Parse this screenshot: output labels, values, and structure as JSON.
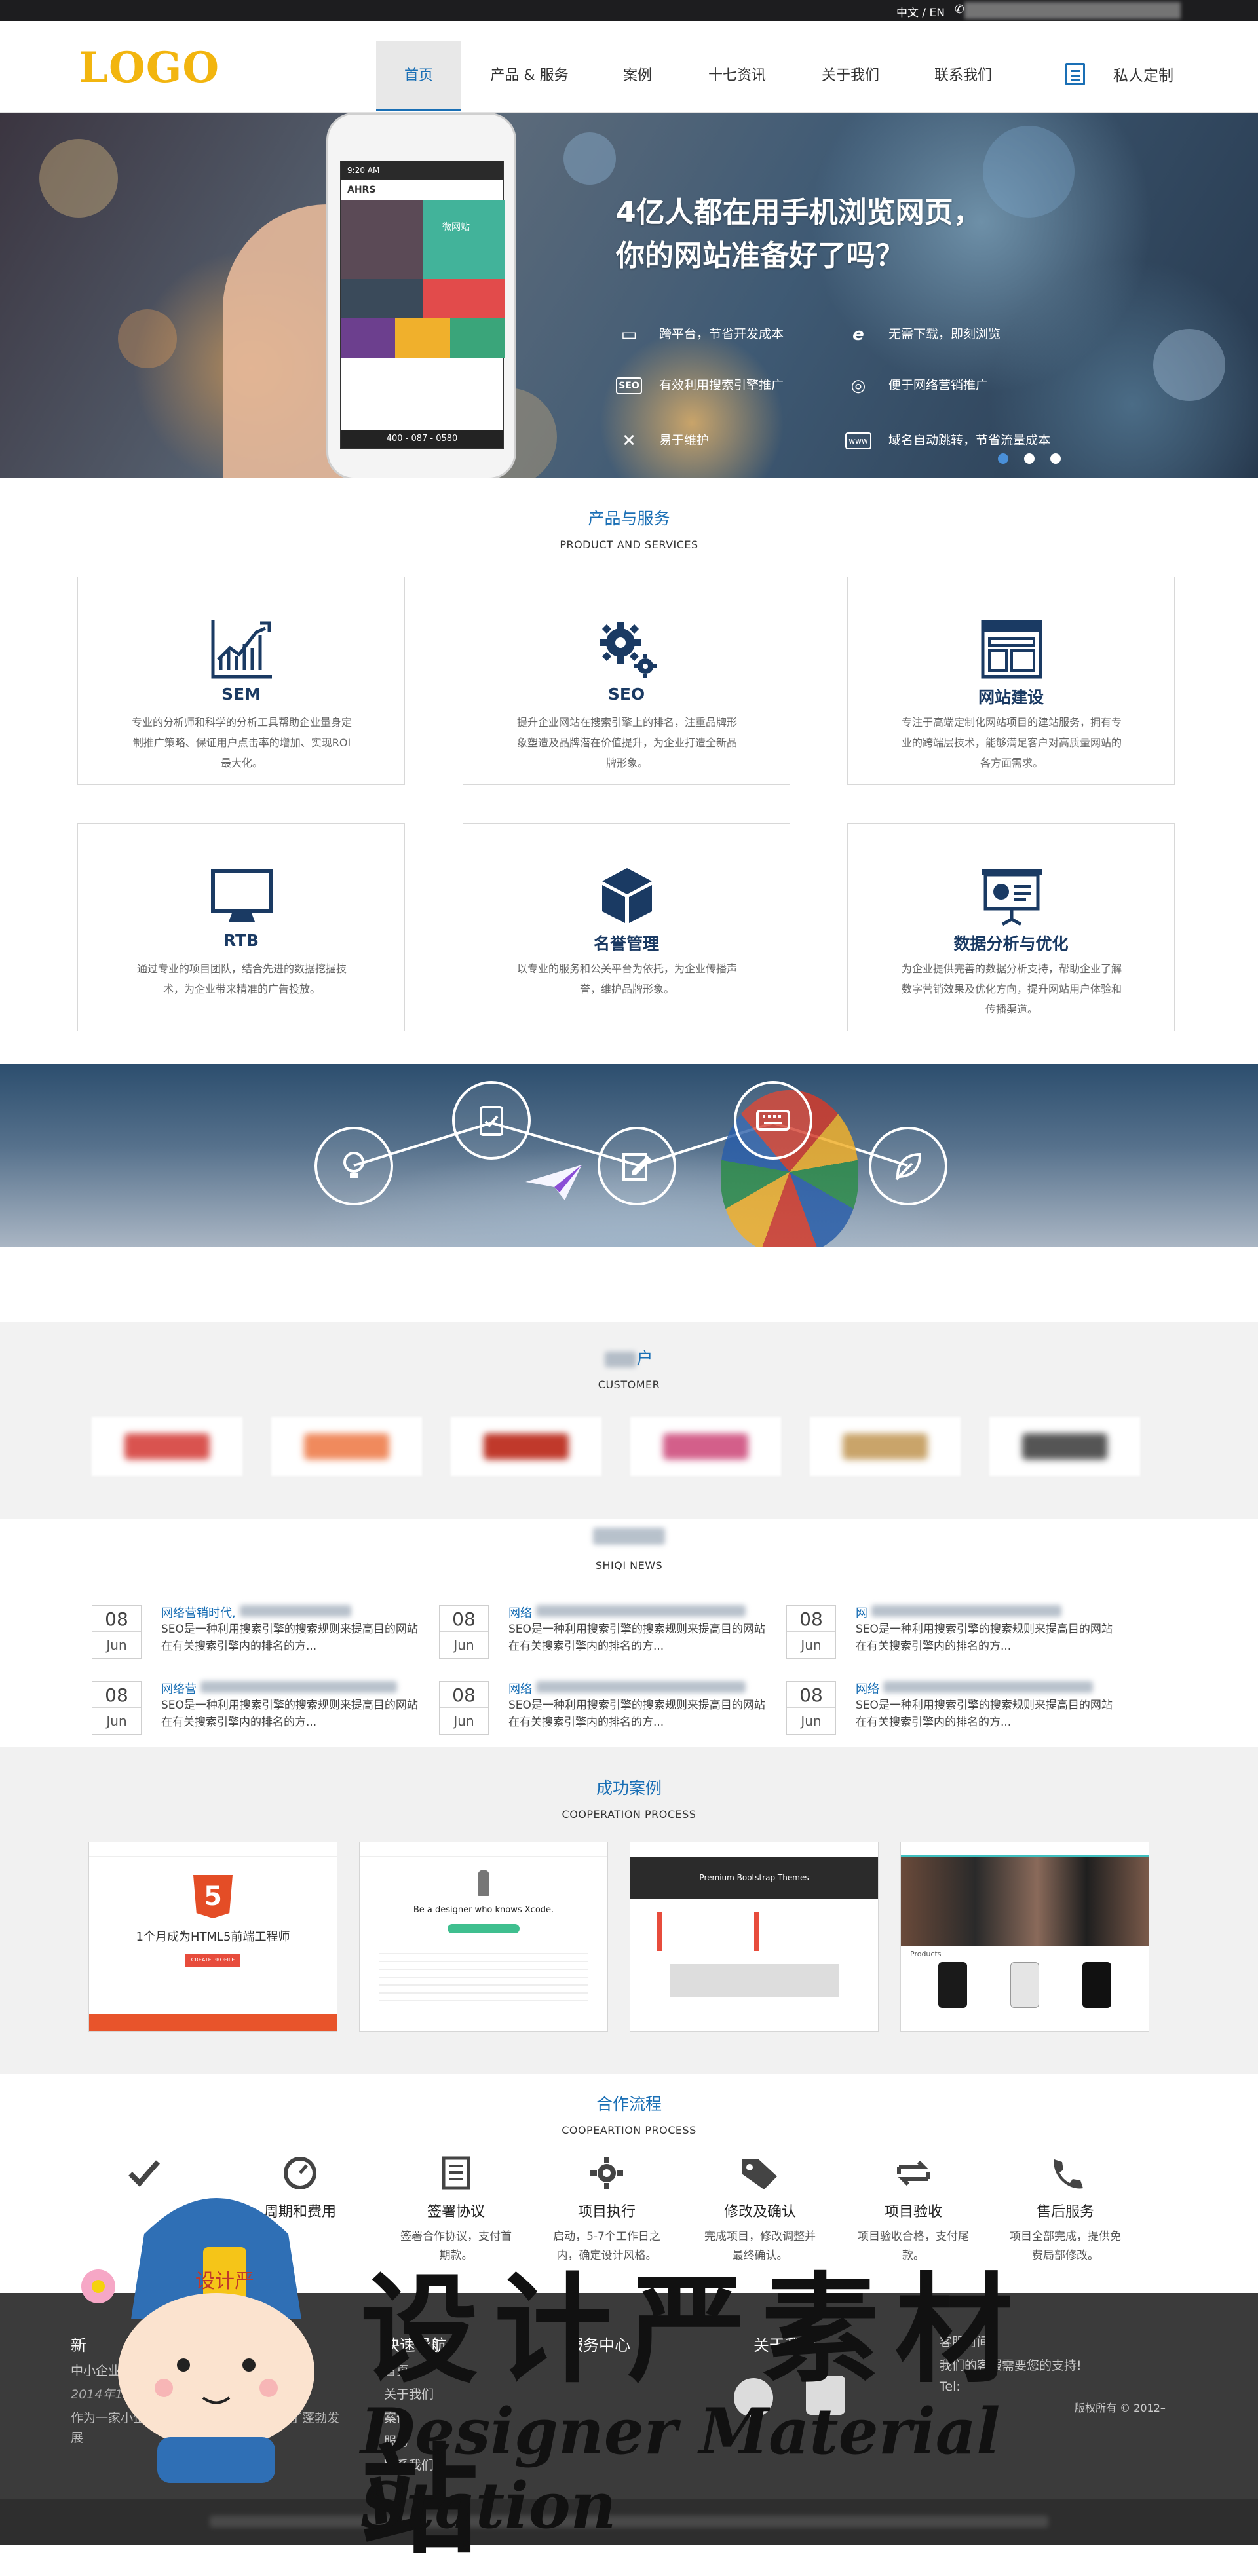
{
  "topbar": {
    "lang": "中文 / EN",
    "phone_icon": "phone-icon"
  },
  "header": {
    "logo": "LOGO",
    "nav": [
      "首页",
      "产品 & 服务",
      "案例",
      "十七资讯",
      "关于我们",
      "联系我们"
    ],
    "custom_label": "私人定制"
  },
  "hero": {
    "title_line1": "4亿人都在用手机浏览网页，",
    "title_line2": "你的网站准备好了吗？",
    "features": [
      {
        "icon": "monitor-icon",
        "glyph": "🖥",
        "text": "跨平台，节省开发成本"
      },
      {
        "icon": "ie-icon",
        "glyph": "e",
        "text": "无需下载，即刻浏览"
      },
      {
        "icon": "seo-icon",
        "glyph": "SEO",
        "text": "有效利用搜索引擎推广"
      },
      {
        "icon": "compass-icon",
        "glyph": "◎",
        "text": "便于网络营销推广"
      },
      {
        "icon": "wrench-icon",
        "glyph": "✕",
        "text": "易于维护"
      },
      {
        "icon": "www-icon",
        "glyph": "www",
        "text": "域名自动跳转，节省流量成本"
      }
    ],
    "phone": {
      "time": "9:20 AM",
      "brand": "AHRS",
      "tile_label": "微网站",
      "footer_phone": "400 - 087 - 0580"
    },
    "slides": 3,
    "active_slide": 1
  },
  "services": {
    "title": "产品与服务",
    "subtitle": "PRODUCT AND    SERVICES",
    "cards": [
      {
        "icon": "chart-icon",
        "name": "SEM",
        "desc": "专业的分析师和科学的分析工具帮助企业量身定制推广策略、保证用户点击率的增加、实现ROI最大化。"
      },
      {
        "icon": "gears-icon",
        "name": "SEO",
        "desc": "提升企业网站在搜索引擎上的排名，注重品牌形象塑造及品牌潜在价值提升，为企业打造全新品牌形象。"
      },
      {
        "icon": "browser-icon",
        "name": "网站建设",
        "desc": "专注于高端定制化网站项目的建站服务，拥有专业的跨端层技术，能够满足客户对高质量网站的各方面需求。"
      },
      {
        "icon": "monitor-icon",
        "name": "RTB",
        "desc": "通过专业的项目团队，结合先进的数据挖掘技术，为企业带来精准的广告投放。"
      },
      {
        "icon": "cube-icon",
        "name": "名誉管理",
        "desc": "以专业的服务和公关平台为依托，为企业传播声誉，维护品牌形象。"
      },
      {
        "icon": "presentation-icon",
        "name": "数据分析与优化",
        "desc": "为企业提供完善的数据分析支持，帮助企业了解数字营销效果及优化方向，提升网站用户体验和传播渠道。"
      }
    ]
  },
  "process_banner": {
    "icons": [
      "lightbulb-icon",
      "clipboard-icon",
      "paper-plane-icon",
      "edit-icon",
      "keyboard-icon",
      "leaf-icon"
    ]
  },
  "customers": {
    "title_tail": "户",
    "subtitle": "CUSTOMER",
    "logo_colors": [
      "#d9534f",
      "#f08a5d",
      "#c0392b",
      "#d35f8a",
      "#c9a46a",
      "#555555"
    ]
  },
  "news": {
    "subtitle": "SHIQI NEWS",
    "items": [
      {
        "day": "08",
        "month": "Jun",
        "title": "网络营销时代,",
        "desc": "SEO是一种利用搜索引擎的搜索规则来提高目的网站在有关搜索引擎内的排名的方..."
      },
      {
        "day": "08",
        "month": "Jun",
        "title": "网络",
        "desc": "SEO是一种利用搜索引擎的搜索规则来提高目的网站在有关搜索引擎内的排名的方..."
      },
      {
        "day": "08",
        "month": "Jun",
        "title": "网",
        "desc": "SEO是一种利用搜索引擎的搜索规则来提高目的网站在有关搜索引擎内的排名的方..."
      },
      {
        "day": "08",
        "month": "Jun",
        "title": "网络营",
        "desc": "SEO是一种利用搜索引擎的搜索规则来提高目的网站在有关搜索引擎内的排名的方..."
      },
      {
        "day": "08",
        "month": "Jun",
        "title": "网络",
        "desc": "SEO是一种利用搜索引擎的搜索规则来提高目的网站在有关搜索引擎内的排名的方..."
      },
      {
        "day": "08",
        "month": "Jun",
        "title": "网络",
        "desc": "SEO是一种利用搜索引擎的搜索规则来提高目的网站在有关搜索引擎内的排名的方..."
      }
    ]
  },
  "cases": {
    "title": "成功案例",
    "subtitle": "COOPERATION PROCESS",
    "items": [
      {
        "headline": "1个月成为HTML5前端工程师",
        "badge": "5",
        "button": "CREATE PROFILE"
      },
      {
        "headline": "Be a designer who knows Xcode."
      },
      {
        "headline": "Premium Bootstrap Themes"
      },
      {
        "headline": "Products"
      }
    ]
  },
  "process": {
    "title": "合作流程",
    "subtitle": "COOPEARTION PROCESS",
    "steps": [
      {
        "icon": "check-icon",
        "name": "",
        "desc": ""
      },
      {
        "icon": "gauge-icon",
        "name": "周期和费用",
        "desc": ""
      },
      {
        "icon": "document-icon",
        "name": "签署协议",
        "desc": "签署合作协议，支付首期款。"
      },
      {
        "icon": "gear-icon",
        "name": "项目执行",
        "desc": "启动，5-7个工作日之内，确定设计风格。"
      },
      {
        "icon": "tag-icon",
        "name": "修改及确认",
        "desc": "完成项目，修改调整并最终确认。"
      },
      {
        "icon": "arrows-icon",
        "name": "项目验收",
        "desc": "项目验收合格，支付尾款。"
      },
      {
        "icon": "phone-icon",
        "name": "售后服务",
        "desc": "项目全部完成，提供免费局部修改。"
      }
    ]
  },
  "footer": {
    "news_title": "新",
    "news_item": "中小企业",
    "news_date": "2014年12月",
    "news_desc": "作为一家小企业，  ...  到来，小企业得到了蓬勃发展",
    "nav_title": "快速导航",
    "nav_links": [
      "首页",
      "关于我们",
      "案例",
      "服务",
      "联系我们"
    ],
    "service_title": "服务中心",
    "about_title": "关于我们",
    "contact_text": "客服时间",
    "contact_tail": "我们的客服需要您的支持!",
    "tel": "Tel:",
    "copyright": "版权所有 © 2012–"
  },
  "watermark": {
    "cn": "设计严素材站",
    "en": "Designer Material Station",
    "badge": "设计严"
  }
}
